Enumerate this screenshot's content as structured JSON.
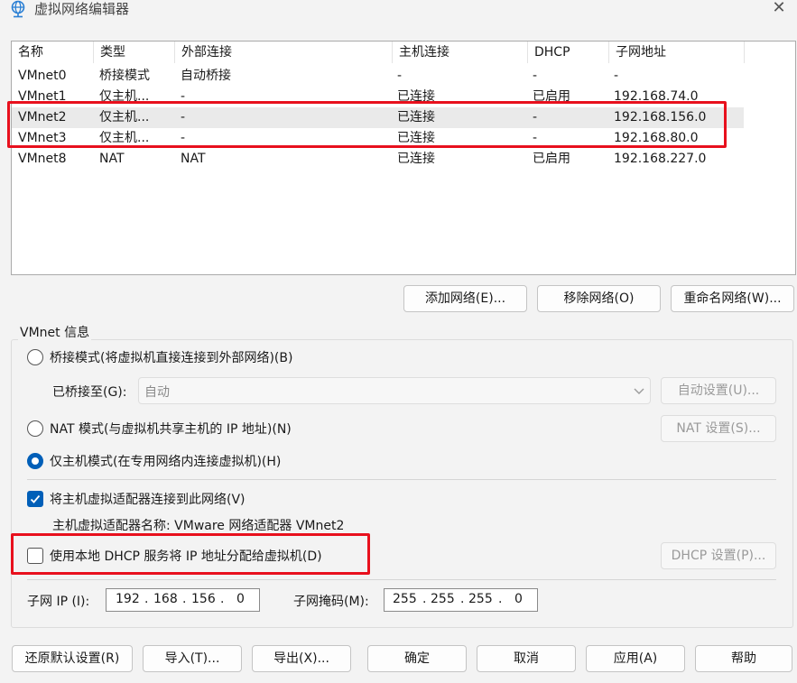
{
  "window": {
    "title": "虚拟网络编辑器",
    "title_icon": "network-globe-icon",
    "close_icon": "close-icon"
  },
  "table": {
    "headers": [
      "名称",
      "类型",
      "外部连接",
      "主机连接",
      "DHCP",
      "子网地址"
    ],
    "rows": [
      {
        "name": "VMnet0",
        "type": "桥接模式",
        "external": "自动桥接",
        "host": "-",
        "dhcp": "-",
        "subnet": "-"
      },
      {
        "name": "VMnet1",
        "type": "仅主机...",
        "external": "-",
        "host": "已连接",
        "dhcp": "已启用",
        "subnet": "192.168.74.0"
      },
      {
        "name": "VMnet2",
        "type": "仅主机...",
        "external": "-",
        "host": "已连接",
        "dhcp": "-",
        "subnet": "192.168.156.0"
      },
      {
        "name": "VMnet3",
        "type": "仅主机...",
        "external": "-",
        "host": "已连接",
        "dhcp": "-",
        "subnet": "192.168.80.0"
      },
      {
        "name": "VMnet8",
        "type": "NAT",
        "external": "NAT",
        "host": "已连接",
        "dhcp": "已启用",
        "subnet": "192.168.227.0"
      }
    ],
    "selected_row": "VMnet2"
  },
  "list_buttons": {
    "add": "添加网络(E)...",
    "remove": "移除网络(O)",
    "rename": "重命名网络(W)..."
  },
  "vmnet_info": {
    "group_title": "VMnet 信息",
    "bridged_label": "桥接模式(将虚拟机直接连接到外部网络)(B)",
    "bridged_to_label": "已桥接至(G):",
    "bridged_to_value": "自动",
    "auto_settings": "自动设置(U)...",
    "nat_label": "NAT 模式(与虚拟机共享主机的 IP 地址)(N)",
    "nat_settings": "NAT 设置(S)...",
    "hostonly_label": "仅主机模式(在专用网络内连接虚拟机)(H)",
    "selected_mode": "hostonly",
    "connect_adapter_label": "将主机虚拟适配器连接到此网络(V)",
    "connect_adapter_checked": true,
    "adapter_name_text": "主机虚拟适配器名称: VMware 网络适配器 VMnet2",
    "dhcp_label": "使用本地 DHCP 服务将 IP 地址分配给虚拟机(D)",
    "dhcp_checked": false,
    "dhcp_settings": "DHCP 设置(P)...",
    "subnet_ip_label": "子网 IP (I):",
    "subnet_ip": [
      "192",
      "168",
      "156",
      "0"
    ],
    "subnet_mask_label": "子网掩码(M):",
    "subnet_mask": [
      "255",
      "255",
      "255",
      "0"
    ]
  },
  "bottom_buttons": {
    "restore": "还原默认设置(R)",
    "import": "导入(T)...",
    "export": "导出(X)...",
    "ok": "确定",
    "cancel": "取消",
    "apply": "应用(A)",
    "help": "帮助"
  },
  "colors": {
    "accent": "#005fb8",
    "highlight_box": "#e8101d",
    "window_bg": "#f3f3f3"
  }
}
